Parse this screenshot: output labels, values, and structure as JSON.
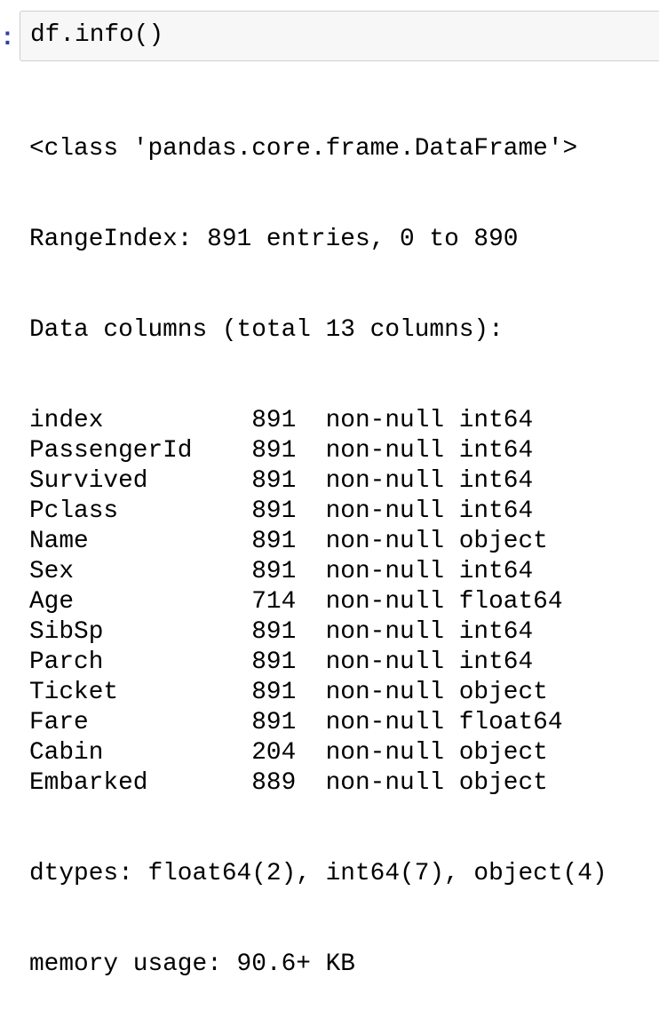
{
  "cell": {
    "prompt": ":",
    "code": "df.info()"
  },
  "output": {
    "header": [
      "<class 'pandas.core.frame.DataFrame'>",
      "RangeIndex: 891 entries, 0 to 890",
      "Data columns (total 13 columns):"
    ],
    "columns": [
      {
        "name": "index",
        "count": "891",
        "info": "non-null int64"
      },
      {
        "name": "PassengerId",
        "count": "891",
        "info": "non-null int64"
      },
      {
        "name": "Survived",
        "count": "891",
        "info": "non-null int64"
      },
      {
        "name": "Pclass",
        "count": "891",
        "info": "non-null int64"
      },
      {
        "name": "Name",
        "count": "891",
        "info": "non-null object"
      },
      {
        "name": "Sex",
        "count": "891",
        "info": "non-null int64"
      },
      {
        "name": "Age",
        "count": "714",
        "info": "non-null float64"
      },
      {
        "name": "SibSp",
        "count": "891",
        "info": "non-null int64"
      },
      {
        "name": "Parch",
        "count": "891",
        "info": "non-null int64"
      },
      {
        "name": "Ticket",
        "count": "891",
        "info": "non-null object"
      },
      {
        "name": "Fare",
        "count": "891",
        "info": "non-null float64"
      },
      {
        "name": "Cabin",
        "count": "204",
        "info": "non-null object"
      },
      {
        "name": "Embarked",
        "count": "889",
        "info": "non-null object"
      }
    ],
    "footer": [
      "dtypes: float64(2), int64(7), object(4)",
      "memory usage: 90.6+ KB"
    ]
  }
}
